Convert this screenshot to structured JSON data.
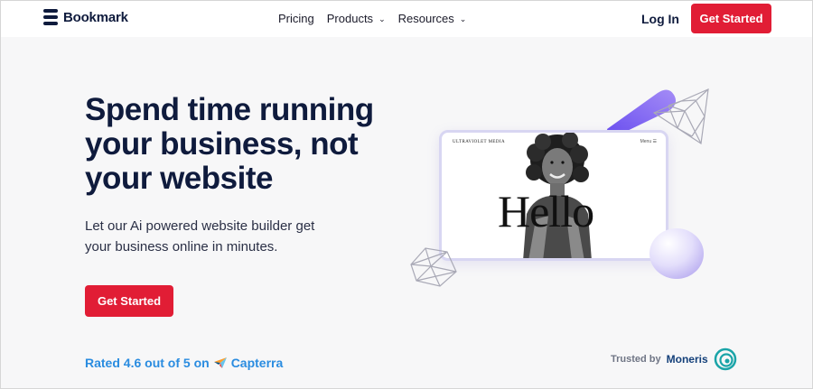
{
  "nav": {
    "logo_text": "Bookmark",
    "links": [
      {
        "label": "Pricing",
        "dropdown": false
      },
      {
        "label": "Products",
        "dropdown": true
      },
      {
        "label": "Resources",
        "dropdown": true
      }
    ],
    "login": "Log In",
    "cta": "Get Started"
  },
  "hero": {
    "title": "Spend time running your business, not your website",
    "subtitle": "Let our Ai powered website builder get your business online in minutes.",
    "cta": "Get Started",
    "rating": "Rated 4.6 out of 5 on",
    "rating_source": "Capterra"
  },
  "preview": {
    "brand": "ULTRAVIOLET MEDIA",
    "menu": "Menu ☰",
    "hello": "Hello"
  },
  "trusted": {
    "label": "Trusted by",
    "partner": "Moneris"
  },
  "colors": {
    "accent": "#e11d35",
    "navy": "#0f1b3d",
    "rating_blue": "#2a8ce0",
    "lavender": "#d8d6f2"
  },
  "icons": {
    "logo": "bookmark-logo-icon",
    "capterra": "capterra-arrow-icon",
    "moneris": "moneris-swirl-icon"
  }
}
